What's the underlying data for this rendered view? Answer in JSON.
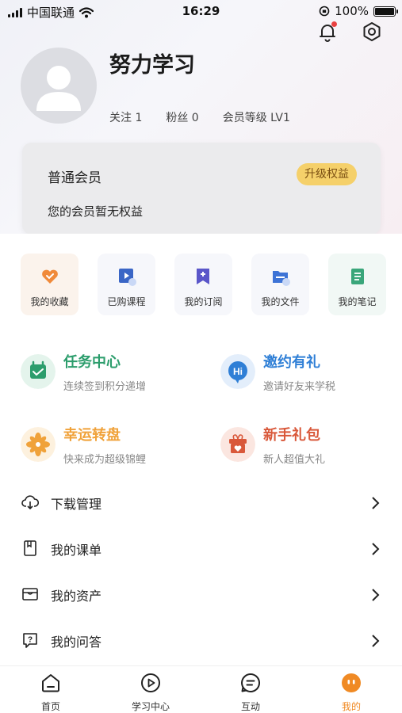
{
  "status_bar": {
    "carrier": "中国联通",
    "time": "16:29",
    "battery": "100%"
  },
  "profile": {
    "name": "努力学习",
    "follow": "关注 1",
    "fans": "粉丝 0",
    "level": "会员等级 LV1"
  },
  "member_card": {
    "title": "普通会员",
    "desc": "您的会员暂无权益",
    "upgrade_label": "升级权益"
  },
  "quick_actions": [
    {
      "label": "我的收藏",
      "icon": "heart-icon"
    },
    {
      "label": "已购课程",
      "icon": "video-course-icon"
    },
    {
      "label": "我的订阅",
      "icon": "bookmark-icon"
    },
    {
      "label": "我的文件",
      "icon": "folder-icon"
    },
    {
      "label": "我的笔记",
      "icon": "notebook-icon"
    }
  ],
  "features": [
    {
      "title": "任务中心",
      "subtitle": "连续签到积分递增",
      "icon": "calendar-icon",
      "color": "#2c9d6c"
    },
    {
      "title": "邀约有礼",
      "subtitle": "邀请好友来学税",
      "icon": "hi-bubble-icon",
      "color": "#2f7fd6"
    },
    {
      "title": "幸运转盘",
      "subtitle": "快来成为超级锦鲤",
      "icon": "pinwheel-icon",
      "color": "#f0a23a"
    },
    {
      "title": "新手礼包",
      "subtitle": "新人超值大礼",
      "icon": "gift-box-icon",
      "color": "#d9583a"
    }
  ],
  "menu": [
    {
      "label": "下载管理",
      "icon": "cloud-download-icon"
    },
    {
      "label": "我的课单",
      "icon": "course-list-icon"
    },
    {
      "label": "我的资产",
      "icon": "assets-icon"
    },
    {
      "label": "我的问答",
      "icon": "question-icon"
    }
  ],
  "tabs": [
    {
      "label": "首页",
      "icon": "home-icon"
    },
    {
      "label": "学习中心",
      "icon": "play-icon"
    },
    {
      "label": "互动",
      "icon": "chat-icon"
    },
    {
      "label": "我的",
      "icon": "face-icon",
      "active": true
    }
  ],
  "colors": {
    "accent": "#f08a24",
    "upgrade_bg": "#f5d06a"
  }
}
